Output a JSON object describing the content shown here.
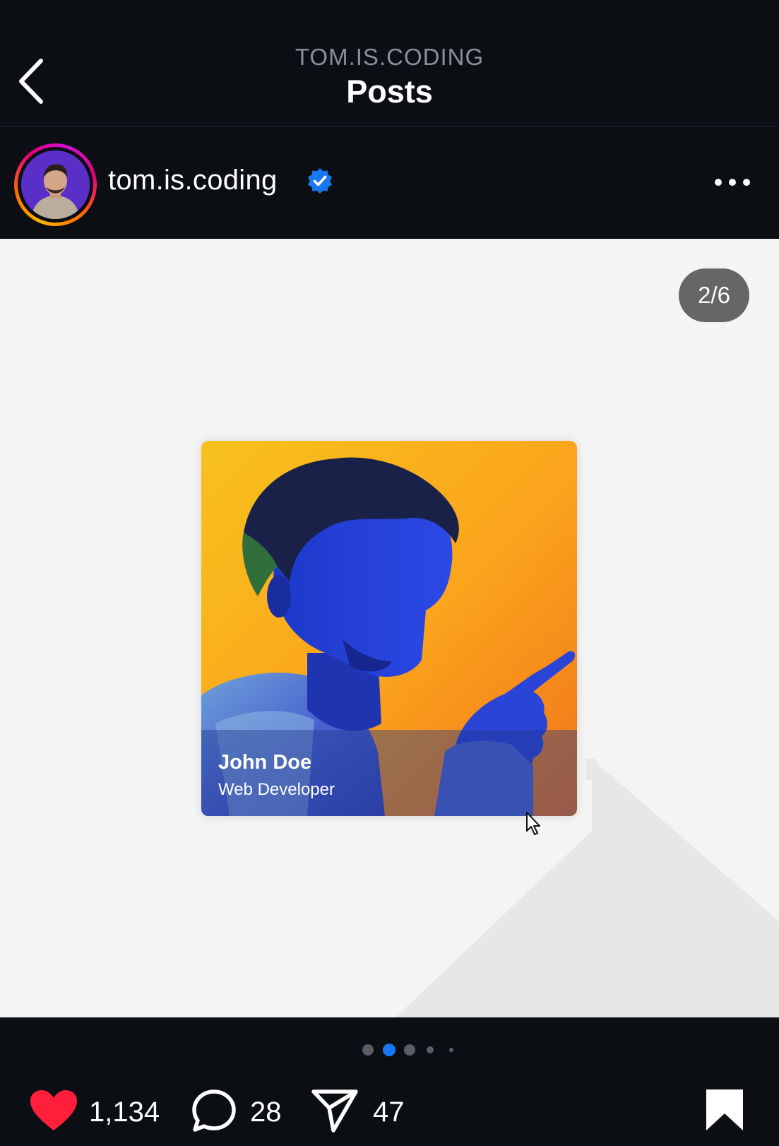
{
  "header": {
    "account_handle": "TOM.IS.CODING",
    "title": "Posts",
    "back_icon": "chevron-left-icon"
  },
  "post": {
    "username": "tom.is.coding",
    "verified_icon": "verified-badge-icon",
    "more_icon": "more-horizontal-icon",
    "slide_counter": "2/6",
    "current_slide": 2,
    "total_slides": 6,
    "card": {
      "name": "John Doe",
      "role": "Web Developer"
    }
  },
  "actions": {
    "likes": "1,134",
    "comments": "28",
    "shares": "47",
    "like_icon": "heart-filled-icon",
    "comment_icon": "comment-bubble-icon",
    "share_icon": "send-icon",
    "save_icon": "bookmark-filled-icon"
  },
  "colors": {
    "background": "#0b0e13",
    "accent": "#1877f2",
    "like": "#ff1f3a",
    "media_bg": "#f4f4f4"
  }
}
